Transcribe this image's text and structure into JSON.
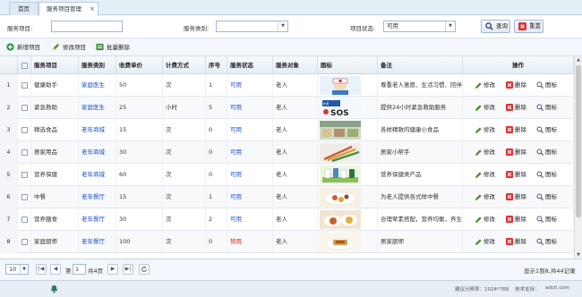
{
  "tabs": {
    "home": "首页",
    "active": "服务项目管理",
    "close": "×"
  },
  "search": {
    "name_label": "服务项目:",
    "name_value": "",
    "category_label": "服务类别:",
    "category_value": "",
    "status_label": "项目状态:",
    "status_value": "可用",
    "query_label": "查询",
    "reset_label": "重置"
  },
  "toolbar": {
    "add": "新增项目",
    "edit": "修改项目",
    "batch_delete": "批量删除"
  },
  "columns": [
    "服务项目",
    "服务类别",
    "收费单价",
    "计费方式",
    "序号",
    "服务状态",
    "服务对象",
    "图标",
    "备注",
    "操作"
  ],
  "rows": [
    {
      "no": "1",
      "name": "健康助手",
      "category": "家庭医生",
      "price": "50",
      "billing": "次",
      "seq": "1",
      "status": "可用",
      "target": "老人",
      "remark": "尊重老人意愿、生活习惯、陪伴",
      "thumb": "nurse"
    },
    {
      "no": "2",
      "name": "紧急救助",
      "category": "家庭医生",
      "price": "25",
      "billing": "小时",
      "seq": "5",
      "status": "可用",
      "target": "老人",
      "remark": "提供24小时紧急救助服务",
      "thumb": "sos"
    },
    {
      "no": "3",
      "name": "精选食品",
      "category": "老年商城",
      "price": "15",
      "billing": "次",
      "seq": "0",
      "status": "可用",
      "target": "老人",
      "remark": "各样精致的健康小食品",
      "thumb": "market"
    },
    {
      "no": "4",
      "name": "居家用品",
      "category": "老年商城",
      "price": "30",
      "billing": "次",
      "seq": "0",
      "status": "可用",
      "target": "老人",
      "remark": "居家小帮手",
      "thumb": "pens"
    },
    {
      "no": "5",
      "name": "营养保健",
      "category": "老年商城",
      "price": "60",
      "billing": "次",
      "seq": "0",
      "status": "可用",
      "target": "老人",
      "remark": "营养保健类产品",
      "thumb": "bottles"
    },
    {
      "no": "6",
      "name": "中餐",
      "category": "老年餐厅",
      "price": "15",
      "billing": "次",
      "seq": "1",
      "status": "可用",
      "target": "老人",
      "remark": "为老人提供各式样中餐",
      "thumb": "dish"
    },
    {
      "no": "7",
      "name": "营养膳食",
      "category": "老年餐厅",
      "price": "30",
      "billing": "次",
      "seq": "2",
      "status": "可用",
      "target": "老人",
      "remark": "合理荤素搭配，营养均衡，养生",
      "thumb": "meal"
    },
    {
      "no": "8",
      "name": "家庭厨师",
      "category": "老年餐厅",
      "price": "100",
      "billing": "次",
      "seq": "0",
      "status": "禁用",
      "target": "老人",
      "remark": "居家厨师",
      "thumb": "chef"
    }
  ],
  "ops": {
    "edit": "修改",
    "delete": "删除",
    "icon": "图标"
  },
  "pager": {
    "page_size": "10",
    "page_label": "第",
    "page_value": "1",
    "total_pages": "共4页",
    "summary": "显示1到8,共44记录"
  },
  "footer": {
    "resolution": "建议分辨率：1024*768",
    "support_label": "技术支持：",
    "support_value": "adcti.com"
  },
  "colors": {
    "accent": "#1b4fc2",
    "danger": "#d22222",
    "header_bg": "#e6eef7"
  }
}
